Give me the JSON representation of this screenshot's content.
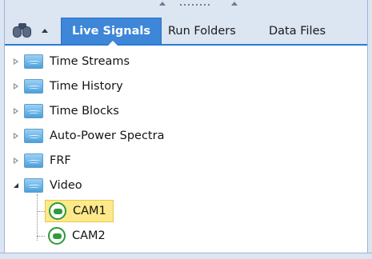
{
  "tabs": {
    "tool_icon": "binoculars-icon",
    "live_signals": "Live Signals",
    "run_folders": "Run Folders",
    "data_files": "Data Files"
  },
  "tree": {
    "items": [
      {
        "label": "Time Streams",
        "expanded": false,
        "icon": "signal-folder-icon"
      },
      {
        "label": "Time History",
        "expanded": false,
        "icon": "signal-folder-icon"
      },
      {
        "label": "Time Blocks",
        "expanded": false,
        "icon": "signal-folder-icon"
      },
      {
        "label": "Auto-Power Spectra",
        "expanded": false,
        "icon": "signal-folder-icon"
      },
      {
        "label": "FRF",
        "expanded": false,
        "icon": "signal-folder-icon"
      },
      {
        "label": "Video",
        "expanded": true,
        "icon": "signal-folder-icon"
      }
    ],
    "video_children": [
      {
        "label": "CAM1",
        "selected": true,
        "icon": "camera-status-icon"
      },
      {
        "label": "CAM2",
        "selected": false,
        "icon": "camera-status-icon"
      }
    ]
  },
  "colors": {
    "accent_tab": "#3d86d8",
    "selection": "#fde98a",
    "camera_green": "#2e9a3c",
    "chrome": "#dce5f2"
  }
}
